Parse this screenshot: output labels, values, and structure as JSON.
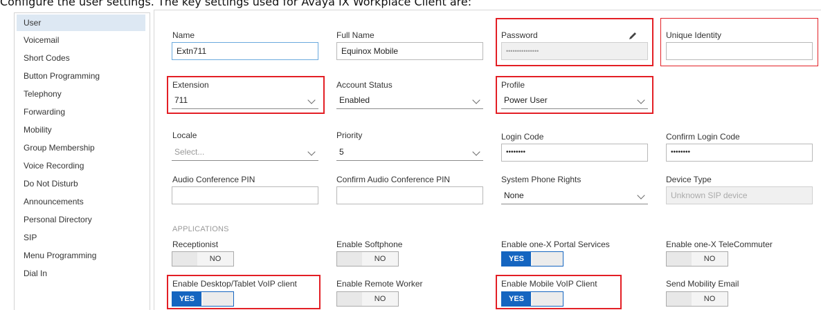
{
  "caption": "Configure the user settings. The key settings used for Avaya IX Workplace Client are:",
  "sidebar": {
    "items": [
      {
        "label": "User",
        "active": true
      },
      {
        "label": "Voicemail"
      },
      {
        "label": "Short Codes"
      },
      {
        "label": "Button Programming"
      },
      {
        "label": "Telephony"
      },
      {
        "label": "Forwarding"
      },
      {
        "label": "Mobility"
      },
      {
        "label": "Group Membership"
      },
      {
        "label": "Voice Recording"
      },
      {
        "label": "Do Not Disturb"
      },
      {
        "label": "Announcements"
      },
      {
        "label": "Personal Directory"
      },
      {
        "label": "SIP"
      },
      {
        "label": "Menu Programming"
      },
      {
        "label": "Dial In"
      }
    ]
  },
  "form": {
    "name": {
      "label": "Name",
      "value": "Extn711"
    },
    "full_name": {
      "label": "Full Name",
      "value": "Equinox Mobile"
    },
    "password": {
      "label": "Password",
      "value": "•••••••••••••••"
    },
    "unique_identity": {
      "label": "Unique Identity",
      "value": ""
    },
    "extension": {
      "label": "Extension",
      "value": "711"
    },
    "account_status": {
      "label": "Account Status",
      "value": "Enabled"
    },
    "profile": {
      "label": "Profile",
      "value": "Power User"
    },
    "locale": {
      "label": "Locale",
      "placeholder": "Select..."
    },
    "priority": {
      "label": "Priority",
      "value": "5"
    },
    "login_code": {
      "label": "Login Code",
      "value": "••••••••"
    },
    "confirm_login_code": {
      "label": "Confirm Login Code",
      "value": "••••••••"
    },
    "audio_conf_pin": {
      "label": "Audio Conference PIN",
      "value": ""
    },
    "confirm_audio_conf_pin": {
      "label": "Confirm Audio Conference PIN",
      "value": ""
    },
    "system_phone_rights": {
      "label": "System Phone Rights",
      "value": "None"
    },
    "device_type": {
      "label": "Device Type",
      "value": "Unknown SIP device"
    }
  },
  "applications": {
    "heading": "APPLICATIONS",
    "receptionist": {
      "label": "Receptionist",
      "state": "NO"
    },
    "softphone": {
      "label": "Enable Softphone",
      "state": "NO"
    },
    "portal": {
      "label": "Enable one-X Portal Services",
      "state": "YES"
    },
    "telecommuter": {
      "label": "Enable one-X TeleCommuter",
      "state": "NO"
    },
    "desktop_voip": {
      "label": "Enable Desktop/Tablet VoIP client",
      "state": "YES"
    },
    "remote_worker": {
      "label": "Enable Remote Worker",
      "state": "NO"
    },
    "mobile_voip": {
      "label": "Enable Mobile VoIP Client",
      "state": "YES"
    },
    "mobility_email": {
      "label": "Send Mobility Email",
      "state": "NO"
    }
  },
  "colors": {
    "accent": "#1565c0",
    "highlight": "#e31e24",
    "active_nav": "#dde8f3"
  }
}
